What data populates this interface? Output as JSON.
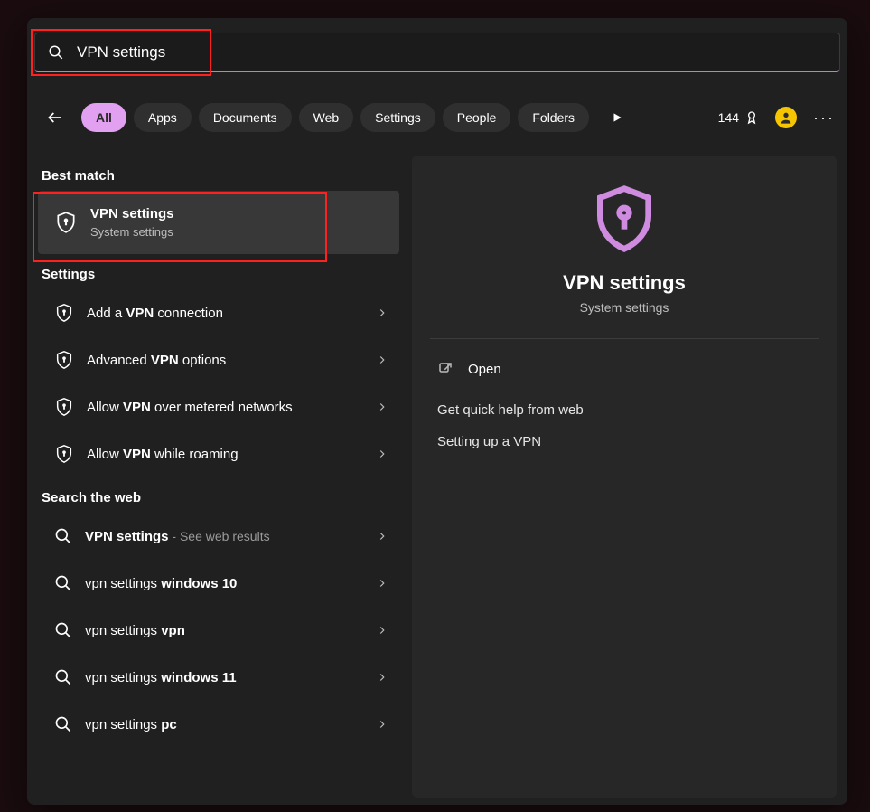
{
  "search": {
    "value": "VPN settings"
  },
  "filters": {
    "items": [
      "All",
      "Apps",
      "Documents",
      "Web",
      "Settings",
      "People",
      "Folders"
    ],
    "active": 0
  },
  "points_badge": "144",
  "sections": {
    "best_match_label": "Best match",
    "best_match": {
      "title": "VPN settings",
      "subtitle": "System settings"
    },
    "settings_label": "Settings",
    "settings": [
      {
        "pre": "Add a ",
        "bold": "VPN",
        "post": " connection"
      },
      {
        "pre": "Advanced ",
        "bold": "VPN",
        "post": " options"
      },
      {
        "pre": "Allow ",
        "bold": "VPN",
        "post": " over metered networks"
      },
      {
        "pre": "Allow ",
        "bold": "VPN",
        "post": " while roaming"
      }
    ],
    "web_label": "Search the web",
    "web": [
      {
        "pre": "",
        "bold": "VPN settings",
        "post": "",
        "extra": " - See web results"
      },
      {
        "pre": "vpn settings ",
        "bold": "windows 10",
        "post": ""
      },
      {
        "pre": "vpn settings ",
        "bold": "vpn",
        "post": ""
      },
      {
        "pre": "vpn settings ",
        "bold": "windows 11",
        "post": ""
      },
      {
        "pre": "vpn settings ",
        "bold": "pc",
        "post": ""
      }
    ]
  },
  "detail": {
    "title": "VPN settings",
    "subtitle": "System settings",
    "open_label": "Open",
    "help_header": "Get quick help from web",
    "links": [
      "Setting up a VPN"
    ]
  }
}
